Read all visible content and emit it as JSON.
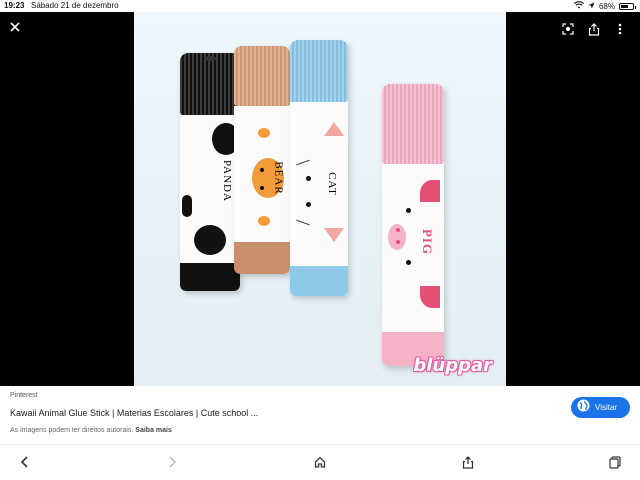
{
  "status_bar": {
    "time": "19:23",
    "date": "Sábado 21 de dezembro",
    "battery": "68%",
    "battery_level": 0.68,
    "icons": [
      "wifi-icon",
      "location-arrow-icon",
      "battery-icon"
    ]
  },
  "viewer": {
    "close_icon": "close-icon",
    "lens_icon": "lens-icon",
    "share_icon": "share-icon",
    "menu_icon": "more-vertical-icon",
    "image": {
      "labels": {
        "panda": "PANDA",
        "bear": "BEAR",
        "cat": "CAT",
        "pig": "PIG"
      },
      "watermark": "blüppar",
      "colors": {
        "background": "#e6f2f7",
        "panda_cap": "#111111",
        "bear_cap": "#d9a07a",
        "cat_cap": "#8ec9ea",
        "pig_cap": "#f5b3c8",
        "bear_face": "#f29b3b",
        "pig_accent": "#e34f75"
      }
    }
  },
  "result": {
    "source": "Pinterest",
    "title": "Kawaii Animal Glue Stick | Materias Escolares | Cute school ...",
    "notice": "As imagens podem ter direitos autorais.",
    "learn_more": "Saiba mais",
    "visit_label": "Visitar",
    "visit_icon": "globe-icon",
    "accent_color": "#1a73e8"
  },
  "toolbar": {
    "icons": [
      "back-icon",
      "forward-icon",
      "home-icon",
      "share-icon",
      "tabs-icon"
    ]
  }
}
